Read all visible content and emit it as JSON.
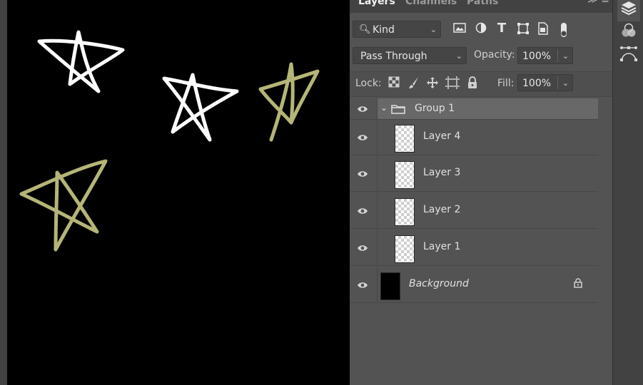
{
  "tabs": [
    {
      "label": "Layers",
      "active": true
    },
    {
      "label": "Channels",
      "active": false
    },
    {
      "label": "Paths",
      "active": false
    }
  ],
  "panel_menu_glyph": "≫ ≡",
  "filter": {
    "kind_label": "Kind"
  },
  "blend": {
    "mode": "Pass Through",
    "opacity_label": "Opacity:",
    "opacity_value": "100%"
  },
  "lock": {
    "label": "Lock:",
    "fill_label": "Fill:",
    "fill_value": "100%"
  },
  "layers": [
    {
      "name": "Group 1",
      "type": "group",
      "visible": true,
      "expanded": true
    },
    {
      "name": "Layer 4",
      "type": "layer",
      "visible": true
    },
    {
      "name": "Layer 3",
      "type": "layer",
      "visible": true
    },
    {
      "name": "Layer 2",
      "type": "layer",
      "visible": true
    },
    {
      "name": "Layer 1",
      "type": "layer",
      "visible": true
    },
    {
      "name": "Background",
      "type": "background",
      "visible": true,
      "locked": true
    }
  ],
  "colors": {
    "star_white": "#ffffff",
    "star_olive": "#b5b577",
    "canvas": "#000000",
    "panel": "#535353"
  },
  "icons": {
    "filter": [
      "image-filter-icon",
      "adjustment-filter-icon",
      "type-filter-icon",
      "shape-filter-icon",
      "smart-object-filter-icon",
      "filter-toggle-icon"
    ],
    "lock": [
      "lock-transparent-pixels-icon",
      "lock-image-pixels-icon",
      "lock-position-icon",
      "lock-artboard-icon",
      "lock-all-icon"
    ],
    "dock": [
      "layers-panel-icon",
      "channels-panel-icon",
      "paths-panel-icon"
    ]
  }
}
